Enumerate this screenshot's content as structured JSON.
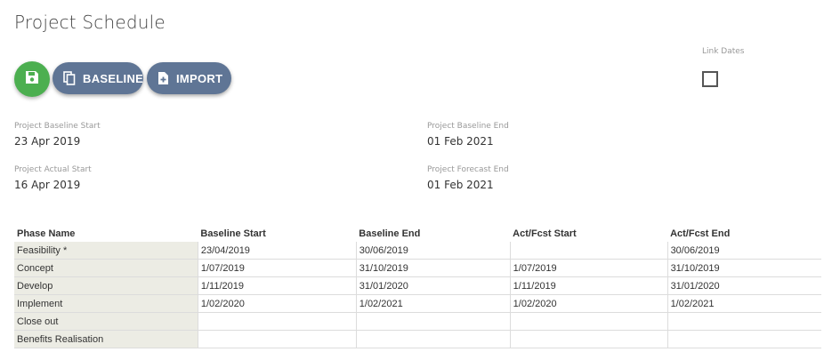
{
  "page": {
    "title": "Project Schedule"
  },
  "toolbar": {
    "baseline_label": "BASELINE",
    "import_label": "IMPORT"
  },
  "link_dates": {
    "label": "Link Dates",
    "checked": false
  },
  "fields": {
    "baseline_start": {
      "label": "Project Baseline Start",
      "value": "23 Apr 2019"
    },
    "baseline_end": {
      "label": "Project Baseline End",
      "value": "01 Feb 2021"
    },
    "actual_start": {
      "label": "Project Actual Start",
      "value": "16 Apr 2019"
    },
    "forecast_end": {
      "label": "Project Forecast End",
      "value": "01 Feb 2021"
    }
  },
  "table": {
    "headers": [
      "Phase Name",
      "Baseline Start",
      "Baseline End",
      "Act/Fcst Start",
      "Act/Fcst End"
    ],
    "rows": [
      [
        "Feasibility *",
        "23/04/2019",
        "30/06/2019",
        "",
        "30/06/2019"
      ],
      [
        "Concept",
        "1/07/2019",
        "31/10/2019",
        "1/07/2019",
        "31/10/2019"
      ],
      [
        "Develop",
        "1/11/2019",
        "31/01/2020",
        "1/11/2019",
        "31/01/2020"
      ],
      [
        "Implement",
        "1/02/2020",
        "1/02/2021",
        "1/02/2020",
        "1/02/2021"
      ],
      [
        "Close out",
        "",
        "",
        "",
        ""
      ],
      [
        "Benefits Realisation",
        "",
        "",
        "",
        ""
      ]
    ]
  },
  "colors": {
    "save": "#4caf50",
    "pill": "#5f7595",
    "phase_bg": "#ecece4"
  }
}
